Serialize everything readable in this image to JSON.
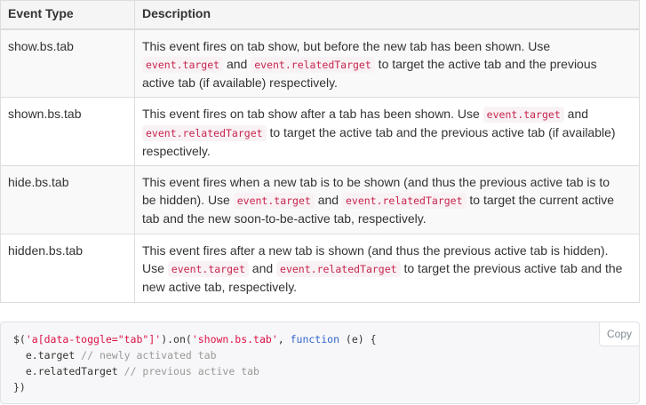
{
  "table": {
    "headers": {
      "event_type": "Event Type",
      "description": "Description"
    },
    "rows": [
      {
        "event": "show.bs.tab",
        "desc_pre": "This event fires on tab show, but before the new tab has been shown. Use ",
        "code1": "event.target",
        "desc_mid": " and ",
        "code2": "event.relatedTarget",
        "desc_post": " to target the active tab and the previous active tab (if available) respectively."
      },
      {
        "event": "shown.bs.tab",
        "desc_pre": "This event fires on tab show after a tab has been shown. Use ",
        "code1": "event.target",
        "desc_mid": " and ",
        "code2": "event.relatedTarget",
        "desc_post": " to target the active tab and the previous active tab (if available) respectively."
      },
      {
        "event": "hide.bs.tab",
        "desc_pre": "This event fires when a new tab is to be shown (and thus the previous active tab is to be hidden). Use ",
        "code1": "event.target",
        "desc_mid": " and ",
        "code2": "event.relatedTarget",
        "desc_post": " to target the current active tab and the new soon-to-be-active tab, respectively."
      },
      {
        "event": "hidden.bs.tab",
        "desc_pre": "This event fires after a new tab is shown (and thus the previous active tab is hidden). Use ",
        "code1": "event.target",
        "desc_mid": " and ",
        "code2": "event.relatedTarget",
        "desc_post": " to target the previous active tab and the new active tab, respectively."
      }
    ]
  },
  "code_example": {
    "copy_label": "Copy",
    "line1": {
      "p1": "$(",
      "s1": "'a[data-toggle=\"tab\"]'",
      "p2": ").on(",
      "s2": "'shown.bs.tab'",
      "p3": ", ",
      "kw": "function",
      "p4": " (e) {"
    },
    "line2": {
      "indent": "  ",
      "code": "e.target",
      "comment": " // newly activated tab"
    },
    "line3": {
      "indent": "  ",
      "code": "e.relatedTarget",
      "comment": " // previous active tab"
    },
    "line4": "})"
  },
  "colors": {
    "inline_code_text": "#c7254e",
    "inline_code_bg": "#f9f2f4",
    "string": "#dd1144",
    "keyword": "#3366cc",
    "comment": "#999999",
    "table_border": "#dddddd",
    "stripe": "#f9f9f9"
  }
}
